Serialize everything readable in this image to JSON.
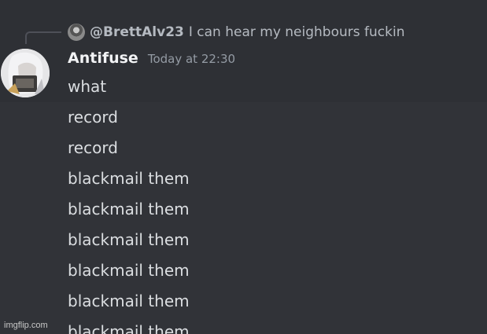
{
  "reply": {
    "author": "@BrettAlv23",
    "text": "I can hear my neighbours fuckin",
    "avatar_icon": "user-avatar-icon"
  },
  "message": {
    "author": "Antifuse",
    "timestamp": "Today at 22:30",
    "avatar_icon": "anime-character-avatar-icon"
  },
  "lines": [
    "what",
    "record",
    "record",
    "blackmail them",
    "blackmail them",
    "blackmail them",
    "blackmail them",
    "blackmail them",
    "blackmail them"
  ],
  "watermark": "imgflip.com",
  "colors": {
    "background": "#313338",
    "highlight": "#2e3035",
    "text": "#dbdee1",
    "muted": "#949ba4",
    "author": "#f2f3f5"
  }
}
